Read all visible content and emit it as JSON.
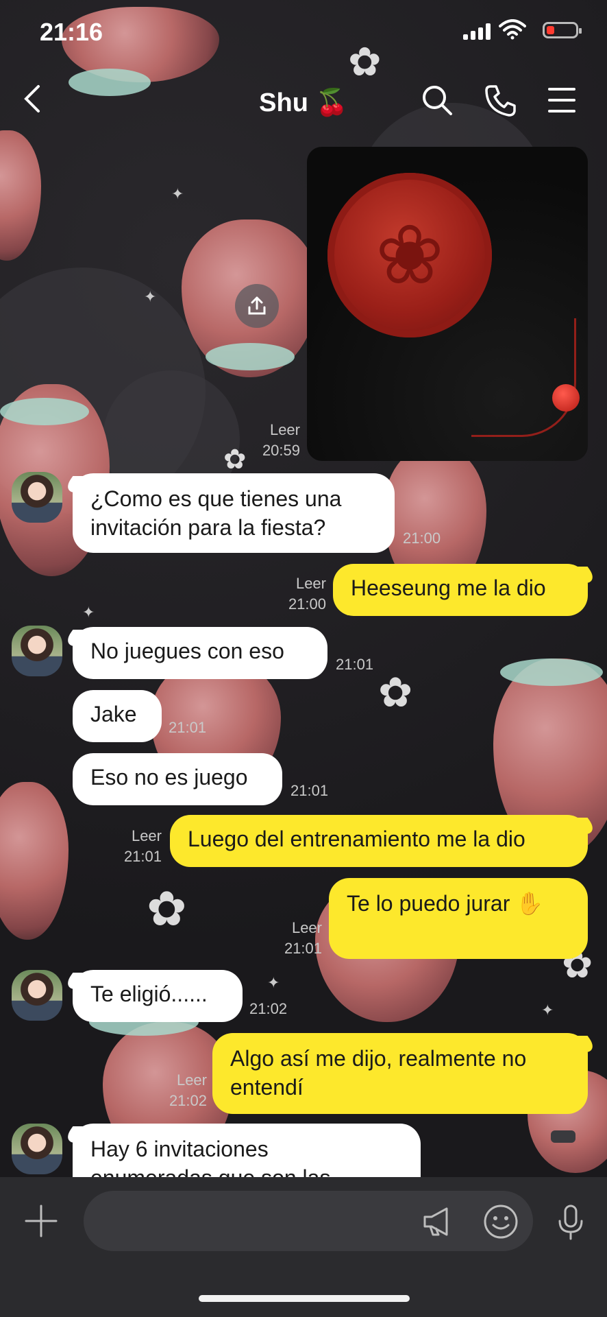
{
  "status_bar": {
    "time": "21:16",
    "battery_color": "#ff3b30"
  },
  "header": {
    "back_icon": "chevron-left-icon",
    "title": "Shu 🍒",
    "search_icon": "search-icon",
    "call_icon": "phone-icon",
    "menu_icon": "menu-icon"
  },
  "image_message": {
    "read_label": "Leer",
    "time": "20:59",
    "share_icon": "share-icon"
  },
  "messages": [
    {
      "side": "in",
      "lines": [
        "¿Como es que tienes una",
        "invitación para la fiesta?"
      ],
      "time": "21:00"
    },
    {
      "side": "out",
      "text": "Heeseung me la dio",
      "read": "Leer",
      "time": "21:00"
    },
    {
      "side": "in",
      "text": "No juegues con eso",
      "time": "21:01"
    },
    {
      "side": "in",
      "text": "Jake",
      "time": "21:01"
    },
    {
      "side": "in",
      "text": "Eso no es juego",
      "time": "21:01"
    },
    {
      "side": "out",
      "text": "Luego del entrenamiento me la dio",
      "read": "Leer",
      "time": "21:01"
    },
    {
      "side": "out",
      "text": "Te lo puedo jurar ✋",
      "read": "Leer",
      "time": "21:01"
    },
    {
      "side": "in",
      "text": "Te eligió......",
      "time": "21:02"
    },
    {
      "side": "out",
      "lines": [
        "Algo así me dijo, realmente no",
        "entendí"
      ],
      "read": "Leer",
      "time": "21:02"
    },
    {
      "side": "in",
      "lines": [
        "Hay 6 invitaciones",
        "enumeradas que son las"
      ]
    }
  ],
  "composer": {
    "placeholder": "",
    "plus_icon": "plus-icon",
    "megaphone_icon": "megaphone-icon",
    "emoji_icon": "emoji-icon",
    "mic_icon": "microphone-icon"
  },
  "colors": {
    "outgoing_bubble": "#fde82c",
    "incoming_bubble": "#ffffff",
    "background": "#1b1a1d"
  }
}
